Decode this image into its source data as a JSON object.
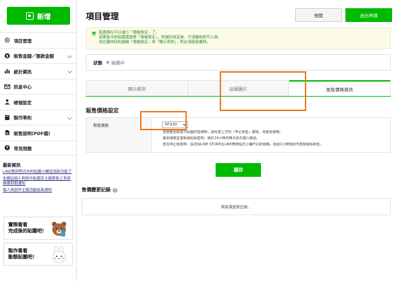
{
  "sidebar": {
    "new_label": "新增",
    "items": [
      {
        "label": "項目管理",
        "icon": "gear-icon",
        "expandable": false
      },
      {
        "label": "販售金額／匯款金額",
        "icon": "coin-icon",
        "expandable": true
      },
      {
        "label": "統計資訊",
        "icon": "chart-icon",
        "expandable": true
      },
      {
        "label": "訊息中心",
        "icon": "envelope-icon",
        "expandable": false
      },
      {
        "label": "帳號設定",
        "icon": "person-icon",
        "expandable": false
      },
      {
        "label": "製作準則",
        "icon": "book-icon",
        "expandable": true
      },
      {
        "label": "販售說明(PDF檔)",
        "icon": "pdf-icon",
        "expandable": false
      },
      {
        "label": "常見問題",
        "icon": "question-icon",
        "expandable": false
      }
    ],
    "news_title": "最新資訊",
    "news": [
      "LINE應用程式內的貼圖小舖追加新功能了",
      "本網站個人與創作貼圖及主題販售之系統維護相關通知",
      "個人與創作主題活動結束通知"
    ],
    "banners": [
      {
        "line1": "實際看看",
        "line2": "完成後的貼圖吧！"
      },
      {
        "line1": "製作看看",
        "line2": "動態貼圖吧！"
      }
    ]
  },
  "header": {
    "title": "項目管理",
    "preview_label": "預覽",
    "submit_label": "送出申請"
  },
  "notice": {
    "line1": "貼圖現在可以進行「價格設定」了。",
    "line2": "若販售中的貼圖需變更「價格設定」，則儲存設定後，不須審核即可上架。",
    "line3": "尚在審核時的編輯「價格設定」與「顯示資訊」，則必須經過審核。"
  },
  "status": {
    "label": "狀態",
    "value": "編輯中"
  },
  "tabs": [
    {
      "label": "顯示資訊",
      "active": false
    },
    {
      "label": "貼圖圖片",
      "active": false
    },
    {
      "label": "販售價格資訊",
      "active": true
    }
  ],
  "pricing": {
    "section_title": "販售價格設定",
    "row_label": "販售價格",
    "selected_price": "NT$30",
    "notes": [
      "若要變更販售中貼圖的售價時，請先按上方的「停止販售」鍵後，再變更價格。",
      "變更價格並重新開始販售時，將於24小時內無法再次進行變更。",
      "若在停止販售時，設定與LINE STORE及LINE應用程式小舖不同的價格，經過1小時後即可重新開始販售。"
    ]
  },
  "save_label": "儲存",
  "history": {
    "title": "售價變更記錄",
    "empty_text": "無售價變更記錄。"
  },
  "colors": {
    "brand_green": "#00b900",
    "highlight_orange": "#e8771e",
    "notice_green": "#2c8a2c"
  }
}
